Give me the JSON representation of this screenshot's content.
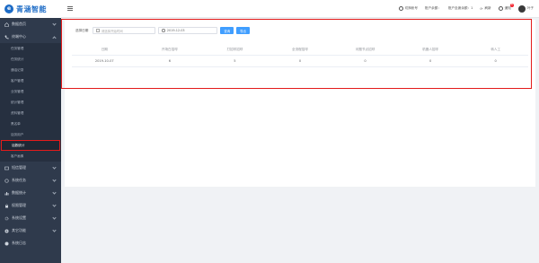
{
  "brand": {
    "name": "青涵智能",
    "mark": "e"
  },
  "sidebar": {
    "groups": [
      {
        "label": "数据首页",
        "open": false
      },
      {
        "label": "终端中心",
        "open": true,
        "items": [
          {
            "label": "任务管理"
          },
          {
            "label": "任务统计"
          },
          {
            "label": "通话记录"
          },
          {
            "label": "客户管理"
          },
          {
            "label": "业务管理"
          },
          {
            "label": "统计管理"
          },
          {
            "label": "资料管理"
          },
          {
            "label": "黑名单"
          },
          {
            "label": "话务用户"
          },
          {
            "label": "话数统计",
            "active": true
          },
          {
            "label": "客户画像"
          }
        ]
      },
      {
        "label": "短信管理",
        "open": false
      },
      {
        "label": "系统任务",
        "open": false
      },
      {
        "label": "数据统计",
        "open": false
      },
      {
        "label": "权限管理",
        "open": false
      },
      {
        "label": "系统设置",
        "open": false
      },
      {
        "label": "其它功能",
        "open": false
      },
      {
        "label": "系统日志",
        "open": false
      }
    ]
  },
  "topbar": {
    "items": [
      {
        "label": "切换帐号",
        "icon": "user-icon"
      },
      {
        "label": "账户余额：",
        "icon": "wallet-icon"
      },
      {
        "label": "账户坐席余额：1",
        "icon": "seat-icon"
      },
      {
        "label": "刷新",
        "icon": "refresh-icon"
      },
      {
        "label": "通知",
        "icon": "bell-icon",
        "badge": "8"
      }
    ],
    "user": "叶子"
  },
  "filter": {
    "label": "选择日期",
    "start_placeholder": "请选择开始时间",
    "end_value": "2019-12-03",
    "search_label": "查询",
    "export_label": "导出"
  },
  "table": {
    "headers": [
      "日期",
      "开场白招呼",
      "打招呼招呼",
      "全流程招呼",
      "问题节点招呼",
      "机器人招呼",
      "转人工"
    ],
    "rows": [
      [
        "2019-10-07",
        "6",
        "5",
        "0",
        "0",
        "0",
        "0"
      ]
    ]
  },
  "colors": {
    "sidebar": "#2f3a4c",
    "accent": "#409eff",
    "highlight": "#e31b1b"
  }
}
